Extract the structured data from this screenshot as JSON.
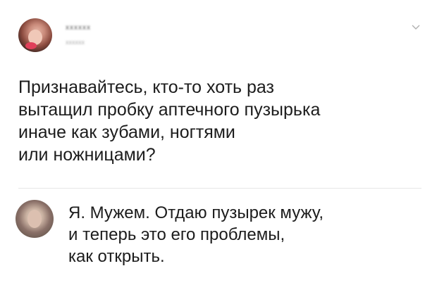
{
  "post": {
    "author_name": "xxxxxx",
    "author_meta": "xxxxxx",
    "question_lines": [
      "Признавайтесь, кто-то хоть раз",
      "вытащил пробку аптечного пузырька",
      "иначе как зубами, ногтями",
      "или ножницами?"
    ]
  },
  "reply": {
    "lines": [
      "Я. Мужем. Отдаю пузырек мужу,",
      "и теперь это его проблемы,",
      "как открыть."
    ]
  },
  "icons": {
    "menu_chevron": "chevron-down-icon"
  }
}
